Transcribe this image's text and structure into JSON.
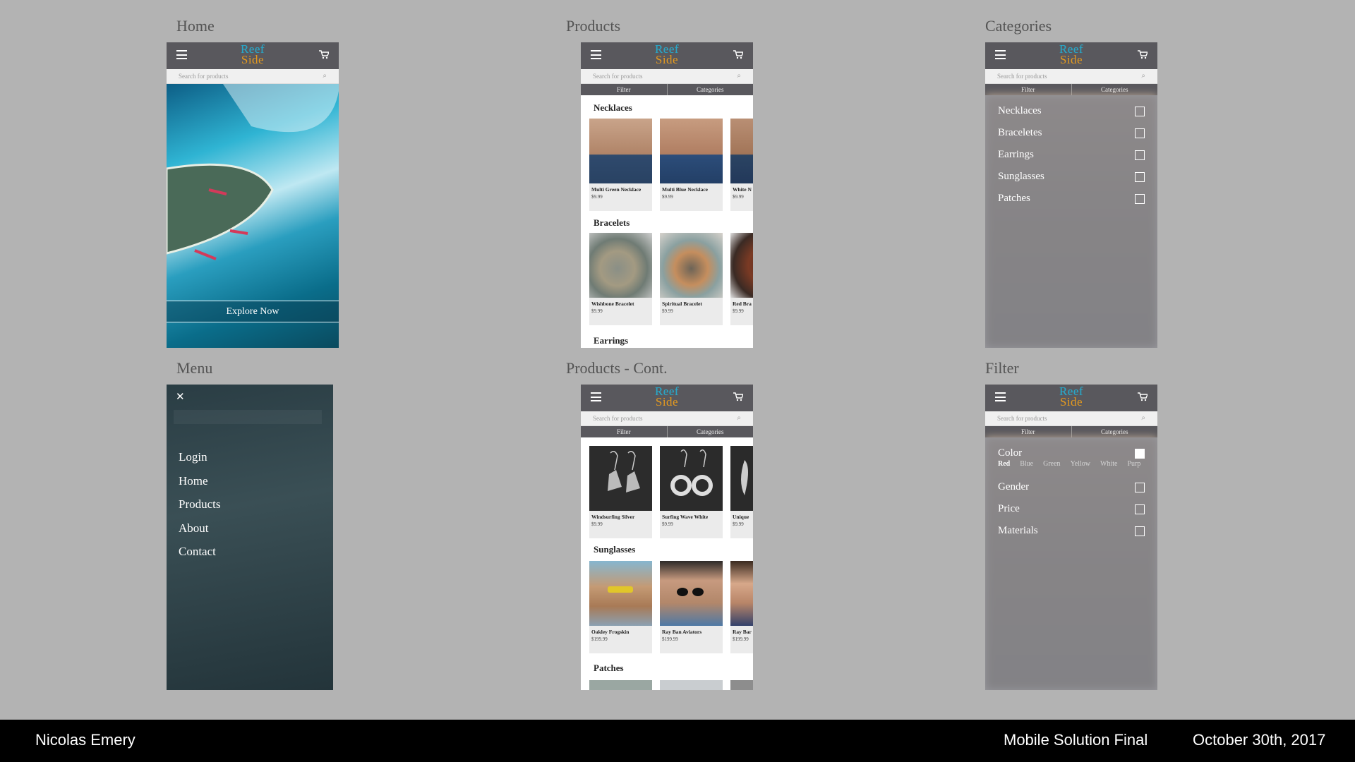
{
  "screens": {
    "home": "Home",
    "products": "Products",
    "categories": "Categories",
    "menu": "Menu",
    "products_cont": "Products - Cont.",
    "filter": "Filter"
  },
  "app": {
    "logo_line1": "Reef",
    "logo_line2": "Side",
    "search_placeholder": "Search for products",
    "tab_filter": "Filter",
    "tab_categories": "Categories"
  },
  "home": {
    "cta": "Explore Now"
  },
  "menu": {
    "close": "✕",
    "items": [
      "Login",
      "Home",
      "Products",
      "About",
      "Contact"
    ]
  },
  "products": {
    "necklaces_title": "Necklaces",
    "necklaces": [
      {
        "name": "Multi Green Necklace",
        "price": "$9.99"
      },
      {
        "name": "Multi Blue Necklace",
        "price": "$9.99"
      },
      {
        "name": "White N",
        "price": "$9.99"
      }
    ],
    "bracelets_title": "Bracelets",
    "bracelets": [
      {
        "name": "Wishbone Bracelet",
        "price": "$9.99"
      },
      {
        "name": "Spiritual Bracelet",
        "price": "$9.99"
      },
      {
        "name": "Red Bra",
        "price": "$9.99"
      }
    ],
    "earrings_title": "Earrings"
  },
  "products_cont": {
    "earrings": [
      {
        "name": "Windsurfing Silver",
        "price": "$9.99"
      },
      {
        "name": "Surfing Wave White",
        "price": "$9.99"
      },
      {
        "name": "Unique",
        "price": "$9.99"
      }
    ],
    "sunglasses_title": "Sunglasses",
    "sunglasses": [
      {
        "name": "Oakley Frogskin",
        "price": "$199.99"
      },
      {
        "name": "Ray Ban Aviators",
        "price": "$199.99"
      },
      {
        "name": "Ray Bar",
        "price": "$199.99"
      }
    ],
    "patches_title": "Patches"
  },
  "categories": [
    "Necklaces",
    "Braceletes",
    "Earrings",
    "Sunglasses",
    "Patches"
  ],
  "filter": {
    "color_label": "Color",
    "colors": [
      "Red",
      "Blue",
      "Green",
      "Yellow",
      "White",
      "Purp"
    ],
    "others": [
      "Gender",
      "Price",
      "Materials"
    ]
  },
  "footer": {
    "author": "Nicolas Emery",
    "project": "Mobile Solution Final",
    "date": "October 30th, 2017"
  },
  "colors": {
    "header": "#59585d",
    "logo_blue": "#2aa6c6",
    "logo_orange": "#e49a1f",
    "background": "#b3b3b3"
  }
}
